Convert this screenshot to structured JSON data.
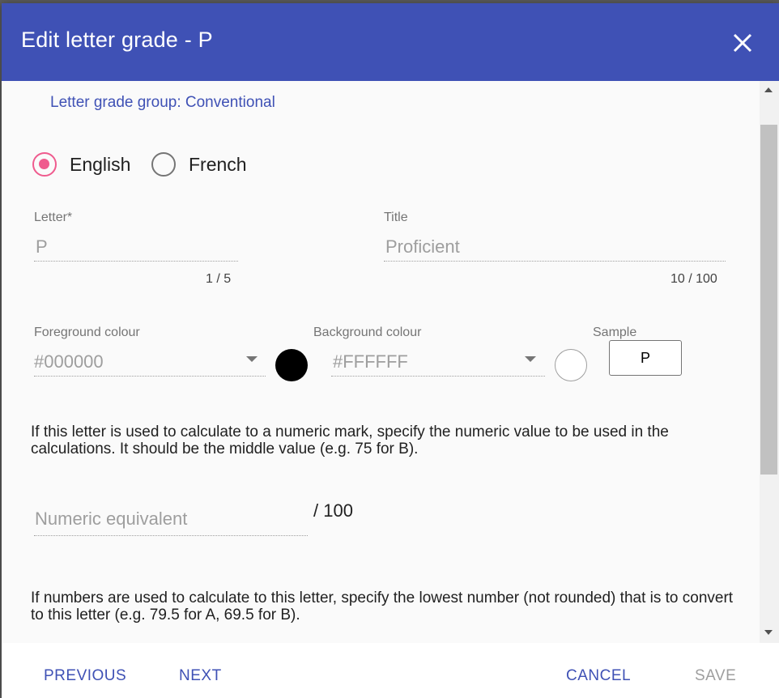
{
  "dialog": {
    "title": "Edit letter grade - P",
    "close_icon": "close-icon"
  },
  "group_label": "Letter grade group: Conventional",
  "language": {
    "options": [
      {
        "label": "English",
        "checked": true
      },
      {
        "label": "French",
        "checked": false
      }
    ],
    "accent_color": "#ef5b8e"
  },
  "letter": {
    "label": "Letter",
    "required_mark": "*",
    "value": "P",
    "counter": "1 / 5"
  },
  "title_field": {
    "label": "Title",
    "value": "Proficient",
    "counter": "10 / 100"
  },
  "foreground": {
    "label": "Foreground colour",
    "value": "#000000",
    "swatch_color": "#000000"
  },
  "background": {
    "label": "Background colour",
    "value": "#FFFFFF",
    "swatch_color": "#FFFFFF"
  },
  "sample": {
    "label": "Sample",
    "text": "P"
  },
  "numeric_help": "If this letter is used to calculate to a numeric mark, specify the numeric value to be used in the calculations. It should be the middle value (e.g. 75 for B).",
  "numeric": {
    "placeholder": "Numeric equivalent",
    "suffix": "/ 100"
  },
  "lowest_help": "If numbers are used to calculate to this letter, specify the lowest number (not rounded) that is to convert to this letter (e.g. 79.5 for A, 69.5 for B).",
  "footer": {
    "previous": "PREVIOUS",
    "next": "NEXT",
    "cancel": "CANCEL",
    "save": "SAVE"
  },
  "colors": {
    "primary": "#3f51b5",
    "radio_checked": "#ef5b8e"
  }
}
